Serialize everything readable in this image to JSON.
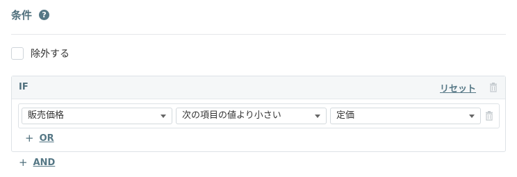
{
  "header": {
    "title": "条件",
    "help_icon": "question-circle-icon"
  },
  "exclude": {
    "label": "除外する",
    "checked": false
  },
  "if_block": {
    "label": "IF",
    "reset_label": "リセット",
    "delete_icon": "trash-icon",
    "condition": {
      "field": "販売価格",
      "operator": "次の項目の値より小さい",
      "value": "定価",
      "delete_icon": "trash-icon"
    },
    "or_label": "OR"
  },
  "and_label": "AND",
  "colors": {
    "accent": "#557785",
    "title": "#4f6f7c",
    "header_bg": "#f5f7f8",
    "border": "#dde2e6"
  }
}
